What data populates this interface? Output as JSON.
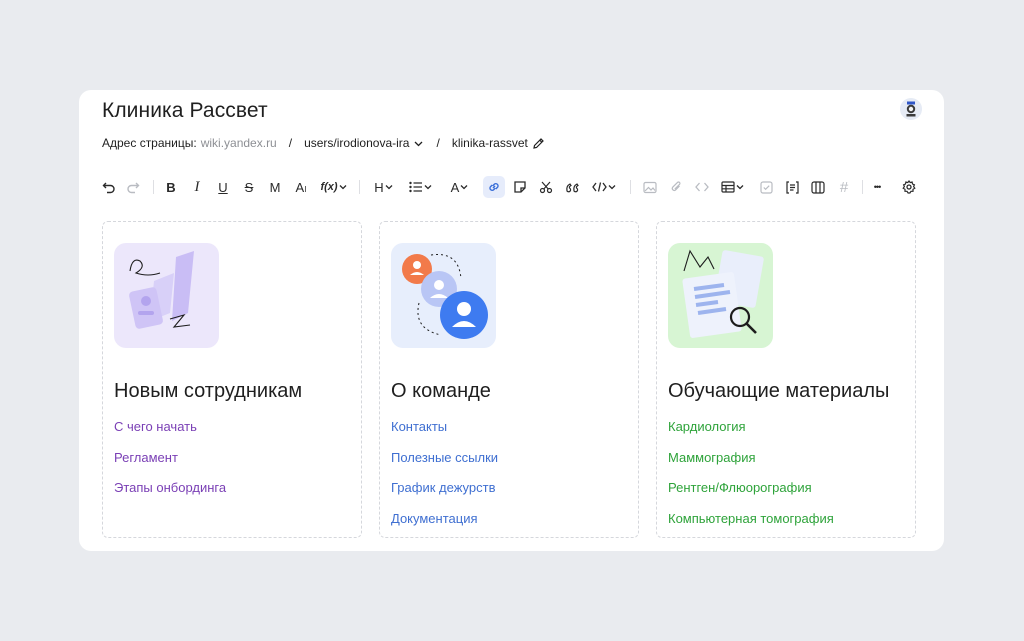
{
  "page": {
    "title": "Клиника Рассвет",
    "address_label": "Адрес страницы:",
    "address_host": "wiki.yandex.ru",
    "address_path_1": "users/irodionova-ira",
    "address_separator": "/",
    "address_path_2": "klinika-rassvet"
  },
  "toolbar": {
    "items": [
      {
        "name": "undo-icon",
        "label": ""
      },
      {
        "name": "redo-icon",
        "label": ""
      },
      {
        "name": "bold-button",
        "label": "B"
      },
      {
        "name": "italic-button",
        "label": "I"
      },
      {
        "name": "underline-button",
        "label": "U"
      },
      {
        "name": "strikethrough-button",
        "label": "S"
      },
      {
        "name": "monospace-button",
        "label": "M"
      },
      {
        "name": "text-size-button",
        "label": "A"
      },
      {
        "name": "function-menu",
        "label": "f(x)"
      },
      {
        "name": "heading-menu",
        "label": "H"
      },
      {
        "name": "list-menu",
        "label": ""
      },
      {
        "name": "text-color-menu",
        "label": "A"
      },
      {
        "name": "link-button",
        "label": ""
      },
      {
        "name": "note-button",
        "label": ""
      },
      {
        "name": "cut-button",
        "label": ""
      },
      {
        "name": "quote-button",
        "label": ""
      },
      {
        "name": "code-menu",
        "label": ""
      },
      {
        "name": "image-button",
        "label": ""
      },
      {
        "name": "attachment-button",
        "label": ""
      },
      {
        "name": "embed-button",
        "label": ""
      },
      {
        "name": "table-menu",
        "label": ""
      },
      {
        "name": "checkbox-button",
        "label": ""
      },
      {
        "name": "yfm-block-button",
        "label": ""
      },
      {
        "name": "columns-button",
        "label": ""
      },
      {
        "name": "hash-button",
        "label": "#"
      },
      {
        "name": "more-button",
        "label": "•••"
      },
      {
        "name": "settings-button",
        "label": ""
      }
    ]
  },
  "cards": [
    {
      "heading": "Новым сотрудникам",
      "link_color": "#7a3fb5",
      "illus_bg": "#ece7fb",
      "links": [
        "С чего начать",
        "Регламент",
        "Этапы онбординга"
      ]
    },
    {
      "heading": "О команде",
      "link_color": "#3f6fd1",
      "illus_bg": "#e7eefc",
      "links": [
        "Контакты",
        "Полезные ссылки",
        "График дежурств",
        "Документация"
      ]
    },
    {
      "heading": "Обучающие материалы",
      "link_color": "#2ea33a",
      "illus_bg": "#d7f5d3",
      "links": [
        "Кардиология",
        "Маммография",
        "Рентген/Флюорография",
        "Компьютерная томография"
      ]
    }
  ]
}
